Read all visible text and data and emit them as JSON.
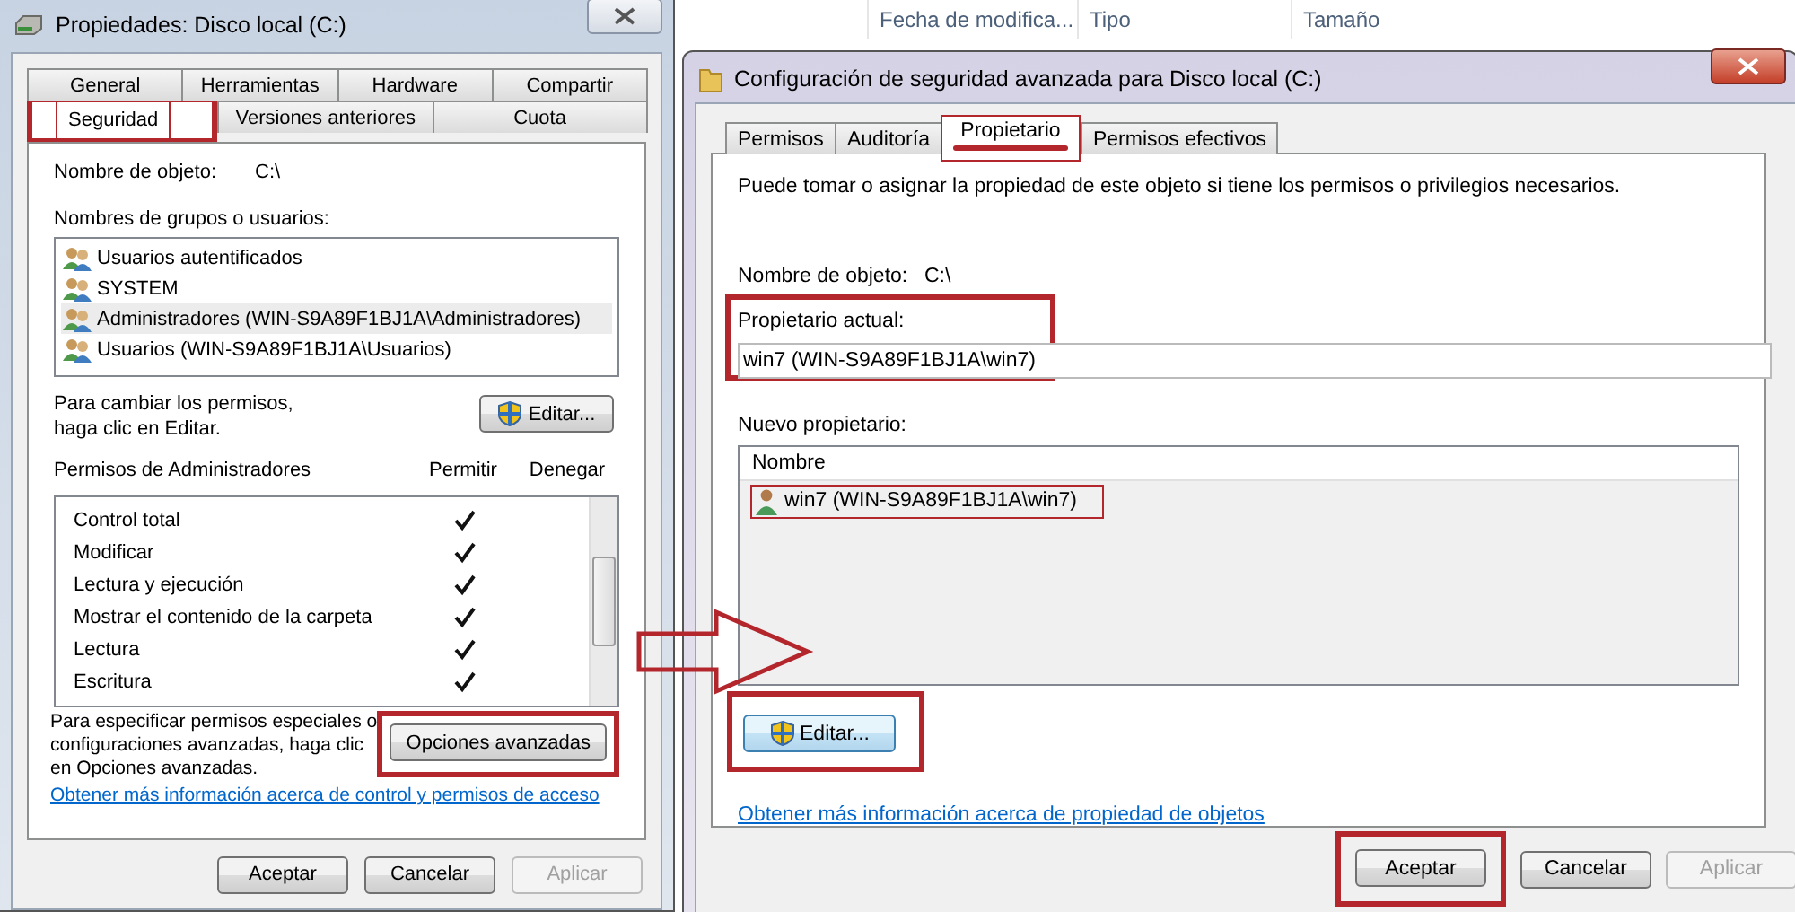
{
  "explorer_header": {
    "columns": [
      "Fecha de modifica...",
      "Tipo",
      "Tamaño"
    ]
  },
  "properties_window": {
    "title": "Propiedades: Disco local (C:)",
    "tab_rows": [
      [
        {
          "label": "General",
          "selected": false,
          "highlighted": false
        },
        {
          "label": "Herramientas",
          "selected": false,
          "highlighted": false
        },
        {
          "label": "Hardware",
          "selected": false,
          "highlighted": false
        },
        {
          "label": "Compartir",
          "selected": false,
          "highlighted": false
        }
      ],
      [
        {
          "label": "Seguridad",
          "selected": true,
          "highlighted": true
        },
        {
          "label": "Versiones anteriores",
          "selected": false,
          "highlighted": false
        },
        {
          "label": "Cuota",
          "selected": false,
          "highlighted": false
        }
      ]
    ],
    "object_label": "Nombre de objeto:",
    "object_value": "C:\\",
    "groups_label": "Nombres de grupos o usuarios:",
    "groups": [
      {
        "name": "Usuarios autentificados",
        "selected": false
      },
      {
        "name": "SYSTEM",
        "selected": false
      },
      {
        "name": "Administradores (WIN-S9A89F1BJ1A\\Administradores)",
        "selected": true
      },
      {
        "name": "Usuarios (WIN-S9A89F1BJ1A\\Usuarios)",
        "selected": false
      }
    ],
    "change_text": "Para cambiar los permisos,\nhaga clic en Editar.",
    "edit_button": "Editar...",
    "permissions_label": "Permisos de Administradores",
    "allow_header": "Permitir",
    "deny_header": "Denegar",
    "permissions": [
      {
        "name": "Control total",
        "allow": true
      },
      {
        "name": "Modificar",
        "allow": true
      },
      {
        "name": "Lectura y ejecución",
        "allow": true
      },
      {
        "name": "Mostrar el contenido de la carpeta",
        "allow": true
      },
      {
        "name": "Lectura",
        "allow": true
      },
      {
        "name": "Escritura",
        "allow": true
      }
    ],
    "advanced_text": "Para especificar permisos especiales o configuraciones avanzadas, haga clic en Opciones avanzadas.",
    "advanced_button": {
      "label": "Opciones avanzadas",
      "highlighted": true
    },
    "help_link": "Obtener más información acerca de control y permisos de acceso",
    "buttons": [
      {
        "label": "Aceptar",
        "disabled": false
      },
      {
        "label": "Cancelar",
        "disabled": false
      },
      {
        "label": "Aplicar",
        "disabled": true
      }
    ]
  },
  "advanced_window": {
    "title": "Configuración de seguridad avanzada para Disco local (C:)",
    "tabs": [
      {
        "label": "Permisos",
        "selected": false,
        "highlighted": false
      },
      {
        "label": "Auditoría",
        "selected": false,
        "highlighted": false
      },
      {
        "label": "Propietario",
        "selected": true,
        "highlighted": true
      },
      {
        "label": "Permisos efectivos",
        "selected": false,
        "highlighted": false
      }
    ],
    "description": "Puede tomar o asignar la propiedad de este objeto si tiene los permisos o privilegios necesarios.",
    "object_label": "Nombre de objeto:",
    "object_value": "C:\\",
    "current_owner": {
      "label": "Propietario actual:",
      "value": "win7 (WIN-S9A89F1BJ1A\\win7)",
      "highlighted": true
    },
    "new_owner_label": "Nuevo propietario:",
    "list_header": "Nombre",
    "owners": [
      {
        "name": "win7 (WIN-S9A89F1BJ1A\\win7)",
        "highlighted": true
      }
    ],
    "edit_button": {
      "label": "Editar...",
      "highlighted": true
    },
    "help_link": "Obtener más información acerca de propiedad de objetos",
    "buttons": [
      {
        "label": "Aceptar",
        "disabled": false,
        "highlighted": true
      },
      {
        "label": "Cancelar",
        "disabled": false,
        "highlighted": false
      },
      {
        "label": "Aplicar",
        "disabled": true,
        "highlighted": false
      }
    ]
  }
}
